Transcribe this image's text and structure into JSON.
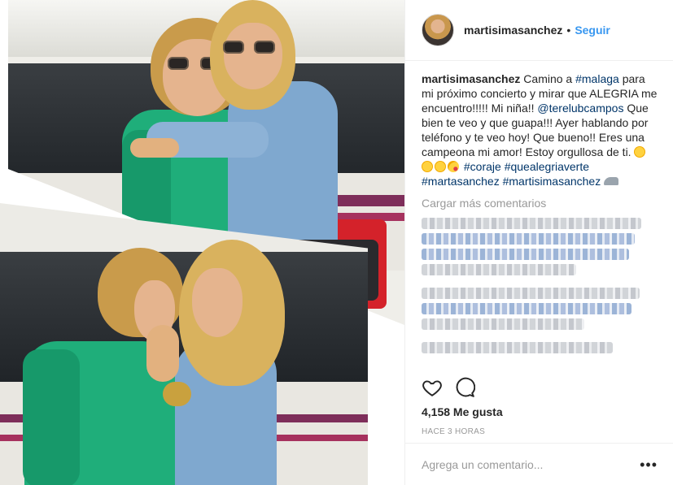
{
  "post": {
    "username": "martisimasanchez",
    "separator": "•",
    "follow_label": "Seguir",
    "avatar_icon": "profile-photo",
    "caption": {
      "username": "martisimasanchez",
      "text_1": " Camino a ",
      "tag_1": "#malaga",
      "text_2": " para mi próximo concierto y mirar que ALEGRIA me encuentro!!!!! Mi niña!! ",
      "tag_2": "@terelubcampos",
      "text_3": " Que bien te veo y que guapa!!! Ayer hablando por teléfono y te veo hoy! Que bueno!! Eres una campeona mi amor! Estoy orgullosa de ti. ",
      "tag_3": "#coraje",
      "tag_4": "#quealegriaverte",
      "tag_5": "#martasanchez",
      "tag_6": "#martisimasanchez"
    },
    "load_more_label": "Cargar más comentarios",
    "likes_label": "4,158 Me gusta",
    "time_label": "HACE 3 HORAS",
    "comment_placeholder": "Agrega un comentario...",
    "more_label": "•••",
    "icons": [
      "heart-icon",
      "comment-icon",
      "more-options-icon",
      "smiley-emoji",
      "kiss-emoji",
      "train-emoji"
    ]
  },
  "colors": {
    "text": "#262626",
    "link_blue": "#3897f0",
    "hashtag": "#003569",
    "muted": "#999999",
    "divider": "#efefef"
  }
}
